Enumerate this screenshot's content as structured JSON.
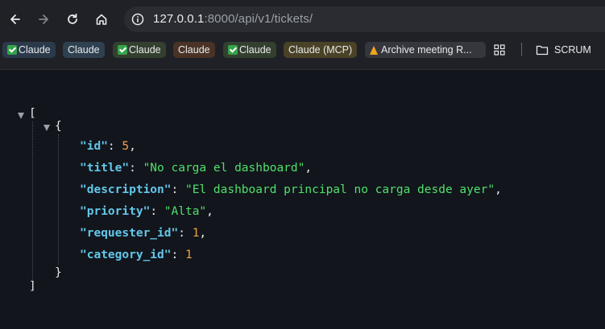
{
  "browser": {
    "url_host": "127.0.0.1",
    "url_rest": ":8000/api/v1/tickets/",
    "nav_icons": [
      "back-arrow-icon",
      "forward-arrow-icon",
      "reload-icon",
      "home-icon"
    ],
    "info_icon": "info-icon"
  },
  "bookmarks": [
    {
      "label": "Claude",
      "icon": "check-icon",
      "bg": "#2b3a4a"
    },
    {
      "label": "Claude",
      "icon": "",
      "bg": "#2f4150"
    },
    {
      "label": "Claude",
      "icon": "check-icon",
      "bg": "#34402f"
    },
    {
      "label": "Claude",
      "icon": "",
      "bg": "#4a3326"
    },
    {
      "label": "Claude",
      "icon": "check-icon",
      "bg": "#34402f"
    },
    {
      "label": "Claude (MCP)",
      "icon": "",
      "bg": "#4a4226"
    },
    {
      "label": "Archive meeting R...",
      "icon": "cone-icon",
      "bg": "#35373d"
    }
  ],
  "bookmark_apps_icon": "apps-grid-icon",
  "bookmark_folder": {
    "label": "SCRUM",
    "icon": "folder-icon"
  },
  "json": {
    "open_bracket": "[",
    "close_bracket": "]",
    "open_brace": "{",
    "close_brace": "}",
    "fields": [
      {
        "key": "\"id\"",
        "sep": ": ",
        "value": "5",
        "type": "num",
        "comma": ","
      },
      {
        "key": "\"title\"",
        "sep": ": ",
        "value": "\"No carga el dashboard\"",
        "type": "str",
        "comma": ","
      },
      {
        "key": "\"description\"",
        "sep": ": ",
        "value": "\"El dashboard principal no carga desde ayer\"",
        "type": "str",
        "comma": ","
      },
      {
        "key": "\"priority\"",
        "sep": ": ",
        "value": "\"Alta\"",
        "type": "str",
        "comma": ","
      },
      {
        "key": "\"requester_id\"",
        "sep": ": ",
        "value": "1",
        "type": "num",
        "comma": ","
      },
      {
        "key": "\"category_id\"",
        "sep": ": ",
        "value": "1",
        "type": "num",
        "comma": ""
      }
    ]
  }
}
